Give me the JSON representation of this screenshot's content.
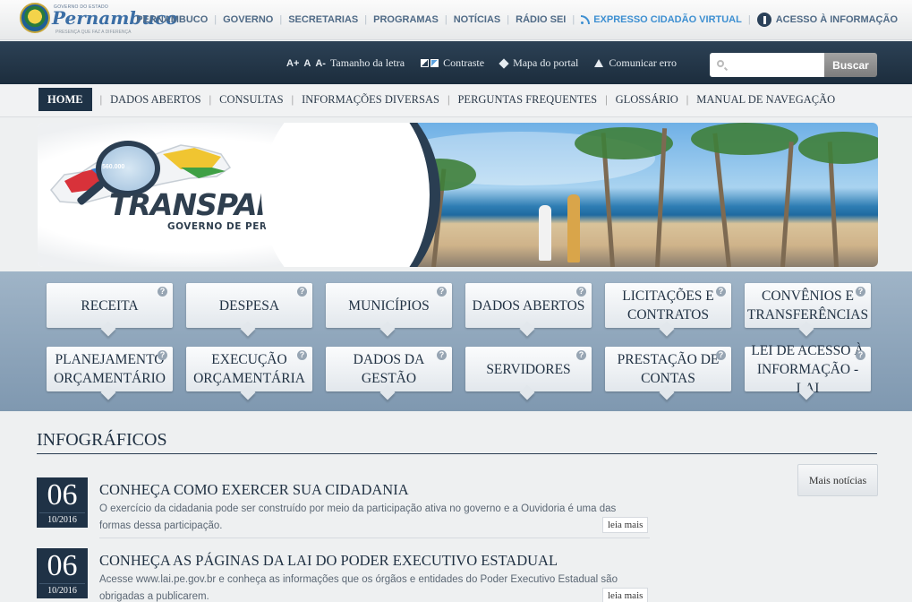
{
  "logo": {
    "name": "Pernambuco",
    "small_text": "GOVERNO DO ESTADO",
    "tagline": "PRESENÇA QUE FAZ A DIFERENÇA"
  },
  "top_nav": {
    "items": [
      "PERNAMBUCO",
      "GOVERNO",
      "SECRETARIAS",
      "PROGRAMAS",
      "NOTÍCIAS",
      "RÁDIO SEI"
    ],
    "expresso": "EXPRESSO CIDADÃO VIRTUAL",
    "acesso": "ACESSO À INFORMAÇÃO"
  },
  "toolbar": {
    "font_increase": "A+",
    "font_normal": "A",
    "font_decrease": "A-",
    "font_size_label": "Tamanho da letra",
    "contrast_label": "Contraste",
    "sitemap_label": "Mapa do portal",
    "report_error_label": "Comunicar erro",
    "search_placeholder": "",
    "search_button": "Buscar"
  },
  "main_nav": {
    "items": [
      "HOME",
      "DADOS ABERTOS",
      "CONSULTAS",
      "INFORMAÇÕES DIVERSAS",
      "PERGUNTAS FREQUENTES",
      "GLOSSÁRIO",
      "MANUAL DE NAVEGAÇÃO"
    ],
    "active": "HOME"
  },
  "banner": {
    "title": "TRANSPARÊNCIA",
    "subtitle": "GOVERNO DE PERNAMBUCO",
    "magnifier_number": "560.000"
  },
  "tiles": [
    {
      "label": "RECEITA"
    },
    {
      "label": "DESPESA"
    },
    {
      "label": "MUNICÍPIOS"
    },
    {
      "label": "DADOS ABERTOS"
    },
    {
      "label": "LICITAÇÕES E CONTRATOS"
    },
    {
      "label": "CONVÊNIOS E TRANSFERÊNCIAS"
    },
    {
      "label": "PLANEJAMENTO ORÇAMENTÁRIO"
    },
    {
      "label": "EXECUÇÃO ORÇAMENTÁRIA"
    },
    {
      "label": "DADOS DA GESTÃO"
    },
    {
      "label": "SERVIDORES"
    },
    {
      "label": "PRESTAÇÃO DE CONTAS"
    },
    {
      "label": "LEI DE ACESSO À INFORMAÇÃO - LAI"
    }
  ],
  "infograficos": {
    "title": "INFOGRÁFICOS",
    "more_button": "Mais notícias",
    "news": [
      {
        "day": "06",
        "month_year": "10/2016",
        "title": "CONHEÇA COMO EXERCER SUA CIDADANIA",
        "text": "O exercício da cidadania pode ser construído por meio da participação ativa no governo e a Ouvidoria é uma das formas dessa participação.",
        "read_more": "leia mais"
      },
      {
        "day": "06",
        "month_year": "10/2016",
        "title": "CONHEÇA AS PÁGINAS DA LAI DO PODER EXECUTIVO ESTADUAL",
        "text": "Acesse www.lai.pe.gov.br e conheça as informações que os órgãos e entidades do Poder Executivo Estadual são obrigadas a publicarem.",
        "read_more": "leia mais"
      }
    ]
  },
  "help_glyph": "?",
  "colors": {
    "navy": "#1f3246",
    "link_blue": "#3d8fd1",
    "tiles_bg": "#8fa7bd"
  }
}
